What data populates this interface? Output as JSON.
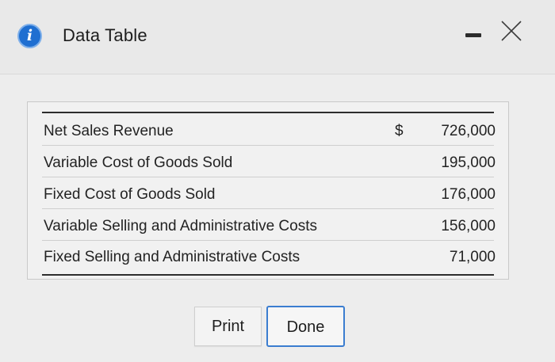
{
  "dialog": {
    "title": "Data Table",
    "info_icon_glyph": "i",
    "accent_color": "#1f6fd1"
  },
  "table": {
    "rows": [
      {
        "label": "Net Sales Revenue",
        "currency": "$",
        "value": "726,000"
      },
      {
        "label": "Variable Cost of Goods Sold",
        "currency": "",
        "value": "195,000"
      },
      {
        "label": "Fixed Cost of Goods Sold",
        "currency": "",
        "value": "176,000"
      },
      {
        "label": "Variable Selling and Administrative Costs",
        "currency": "",
        "value": "156,000"
      },
      {
        "label": "Fixed Selling and Administrative Costs",
        "currency": "",
        "value": "71,000"
      }
    ]
  },
  "buttons": {
    "print_label": "Print",
    "done_label": "Done"
  }
}
